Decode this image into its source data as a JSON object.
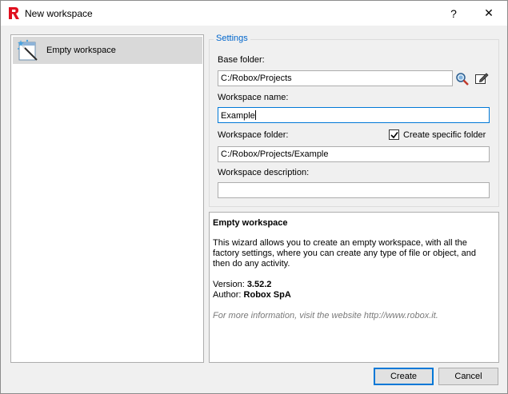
{
  "window": {
    "title": "New workspace",
    "help_label": "?",
    "close_label": "✕",
    "app_icon": "robox-r-logo",
    "accent_color": "#0078d7",
    "brand_color": "#e0101f"
  },
  "wizards": {
    "items": [
      {
        "label": "Empty workspace",
        "icon": "wizard-wand-icon",
        "selected": true
      }
    ]
  },
  "settings": {
    "legend": "Settings",
    "base_folder_label": "Base folder:",
    "base_folder_value": "C:/Robox/Projects",
    "workspace_name_label": "Workspace name:",
    "workspace_name_value": "Example",
    "workspace_folder_label": "Workspace folder:",
    "specific_folder_label": "Create specific folder",
    "specific_folder_checked": true,
    "workspace_folder_value": "C:/Robox/Projects/Example",
    "workspace_description_label": "Workspace description:",
    "workspace_description_value": ""
  },
  "description": {
    "title": "Empty workspace",
    "body": "This wizard allows you to create an empty workspace, with all the factory settings, where you can create any type of file or object, and then do any activity.",
    "version_label": "Version:",
    "version_value": "3.52.2",
    "author_label": "Author:",
    "author_value": "Robox SpA",
    "more_info": "For more information, visit the website http://www.robox.it."
  },
  "buttons": {
    "create_label": "Create",
    "cancel_label": "Cancel"
  }
}
